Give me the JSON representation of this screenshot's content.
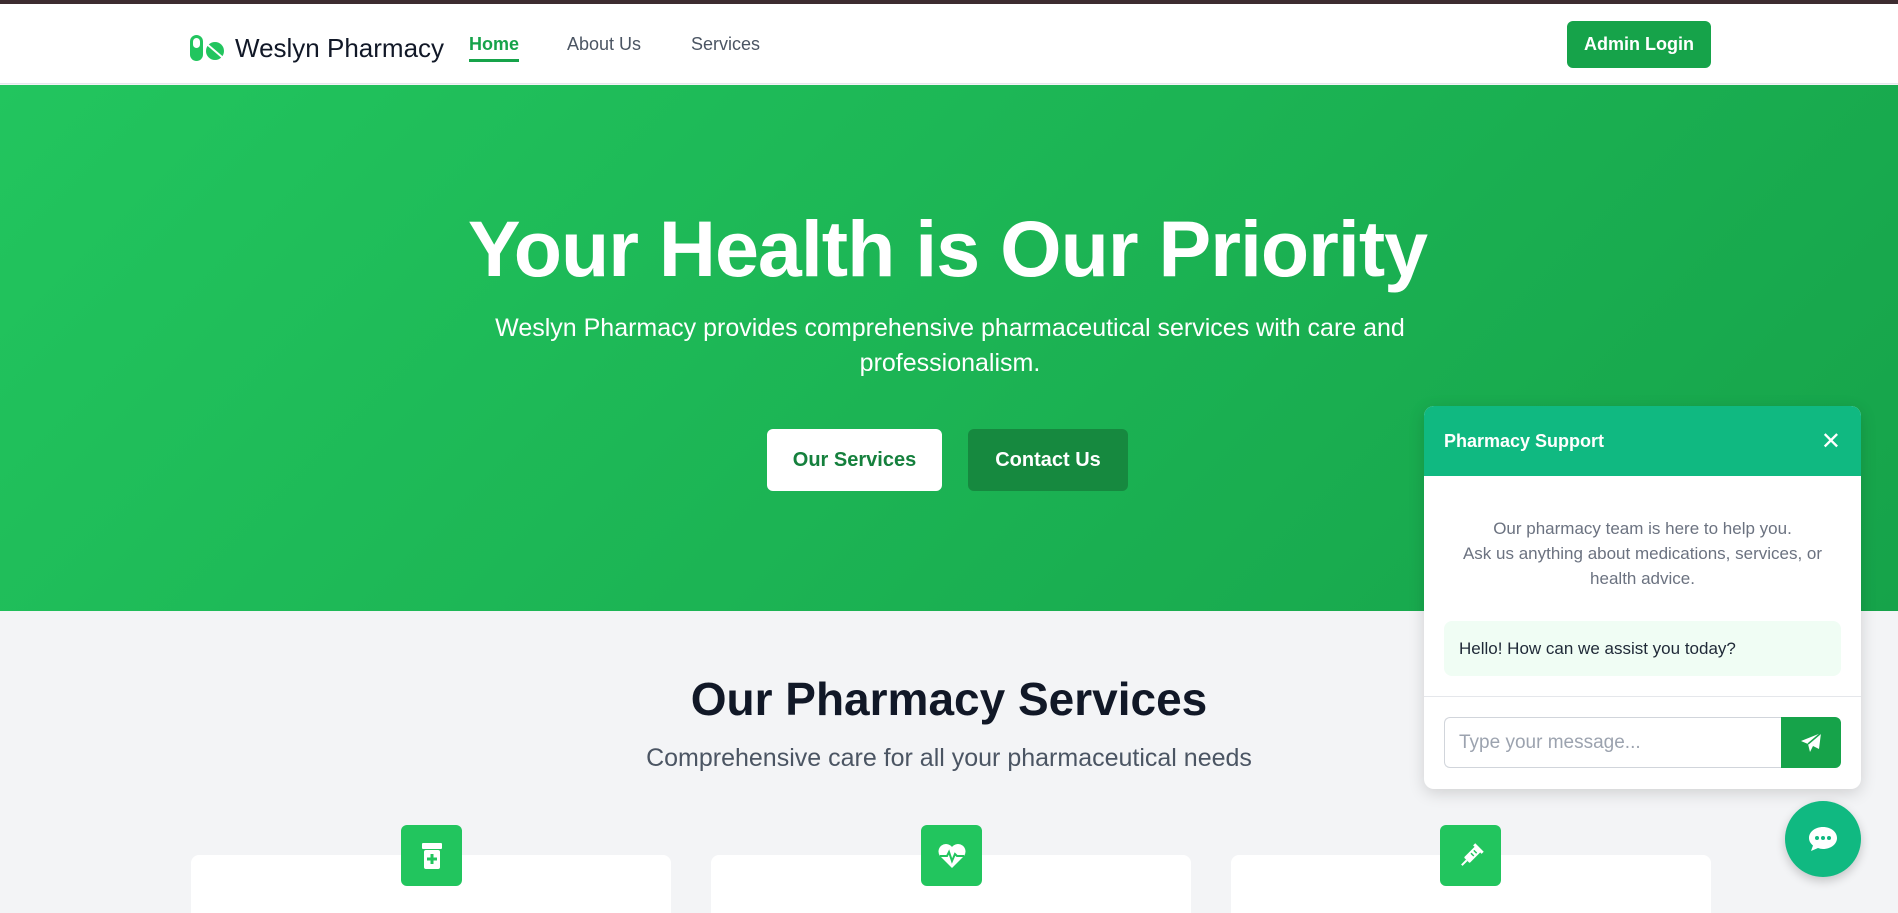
{
  "colors": {
    "brand": "#16a34a",
    "hero_start": "#22c55e",
    "chat_header": "#10b981"
  },
  "nav": {
    "brand_name": "Weslyn Pharmacy",
    "links": [
      {
        "label": "Home",
        "active": true
      },
      {
        "label": "About Us",
        "active": false
      },
      {
        "label": "Services",
        "active": false
      }
    ],
    "admin_label": "Admin Login"
  },
  "hero": {
    "title": "Your Health is Our Priority",
    "subtitle": "Weslyn Pharmacy provides comprehensive pharmaceutical services with care and professionalism.",
    "primary_button": "Our Services",
    "secondary_button": "Contact Us"
  },
  "services": {
    "title": "Our Pharmacy Services",
    "subtitle": "Comprehensive care for all your pharmaceutical needs",
    "cards": [
      {
        "icon": "prescription-bottle-icon"
      },
      {
        "icon": "heartbeat-icon"
      },
      {
        "icon": "syringe-icon"
      }
    ]
  },
  "chat": {
    "title": "Pharmacy Support",
    "intro_line1": "Our pharmacy team is here to help you.",
    "intro_line2": "Ask us anything about medications, services, or health advice.",
    "bot_message": "Hello! How can we assist you today?",
    "input_placeholder": "Type your message..."
  }
}
